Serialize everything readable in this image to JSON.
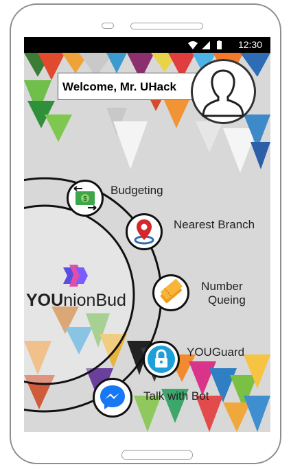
{
  "status": {
    "time": "12:30"
  },
  "welcome": {
    "text": "Welcome, Mr. UHack"
  },
  "brand": {
    "bold": "YOU",
    "rest": "nionBud"
  },
  "menu": [
    {
      "label": "Budgeting"
    },
    {
      "label": "Nearest Branch"
    },
    {
      "label_line1": "Number",
      "label_line2": "Queing"
    },
    {
      "label": "YOUGuard"
    },
    {
      "label": "Talk with Bot"
    }
  ],
  "colors": {
    "status_bar": "#000000",
    "ring": "#111111",
    "logo": "#7b5cff"
  }
}
